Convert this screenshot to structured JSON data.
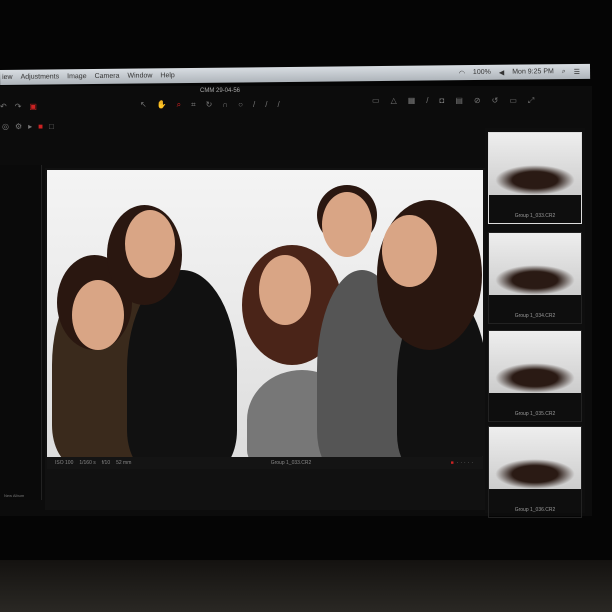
{
  "menubar": {
    "items": [
      "iew",
      "Adjustments",
      "Image",
      "Camera",
      "Window",
      "Help"
    ],
    "battery": "100%",
    "clock": "Mon 9:25 PM"
  },
  "window": {
    "title": "CMM 29-04-56"
  },
  "viewer": {
    "iso": "ISO 100",
    "shutter": "1/160 s",
    "aperture": "f/10",
    "focal": "52 mm",
    "filename": "Group 1_033.CR2"
  },
  "browser": {
    "thumbnails": [
      {
        "label": "Group 1_033.CR2"
      },
      {
        "label": "Group 1_034.CR2"
      },
      {
        "label": "Group 1_035.CR2"
      },
      {
        "label": "Group 1_036.CR2"
      }
    ]
  },
  "left_panel": {
    "dropdown": "New Album"
  }
}
